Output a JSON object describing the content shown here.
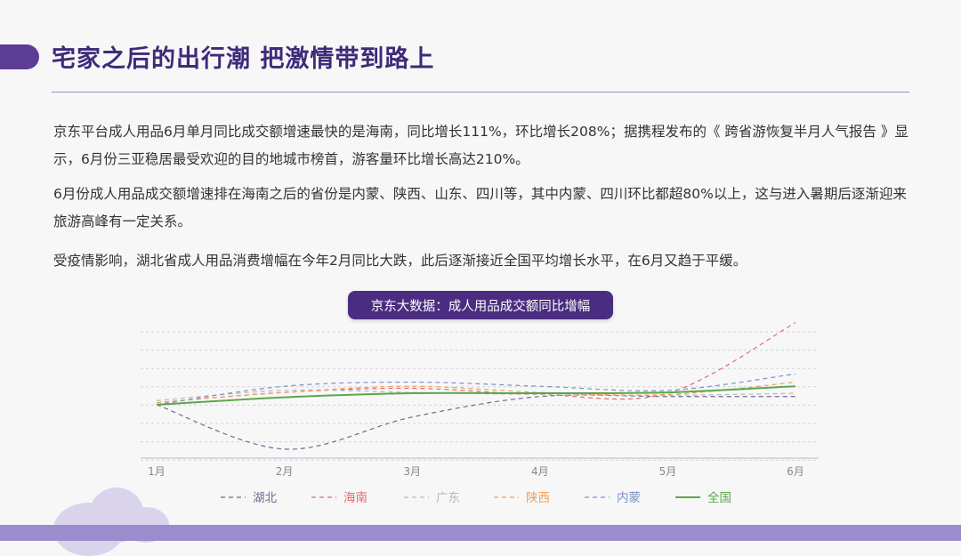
{
  "page": {
    "title": "宅家之后的出行潮 把激情带到路上",
    "paragraphs": [
      "京东平台成人用品6月单月同比成交额增速最快的是海南，同比增长111%，环比增长208%；据携程发布的《 跨省游恢复半月人气报告 》显示，6月份三亚稳居最受欢迎的目的地城市榜首，游客量环比增长高达210%。",
      "6月份成人用品成交额增速排在海南之后的省份是内蒙、陕西、山东、四川等，其中内蒙、四川环比都超80%以上，这与进入暑期后逐渐迎来旅游高峰有一定关系。",
      "受疫情影响，湖北省成人用品消费增幅在今年2月同比大跌，此后逐渐接近全国平均增长水平，在6月又趋于平缓。"
    ],
    "chart_badge": "京东大数据：成人用品成交额同比增幅"
  },
  "colors": {
    "title": "#3e2b78",
    "accent": "#5b3d95",
    "badge_bg": "#4a2d80",
    "band": "#9d8ccd",
    "cloud": "#d9d3ec"
  },
  "chart_data": {
    "type": "line",
    "categories": [
      "1月",
      "2月",
      "3月",
      "4月",
      "5月",
      "6月"
    ],
    "ylim": [
      -130,
      210
    ],
    "grid": true,
    "y_axis_labels": false,
    "legend_position": "bottom",
    "series": [
      {
        "name": "湖北",
        "color": "#6e6a8e",
        "dashed": true,
        "width": 1.2,
        "values": [
          0,
          -108,
          -30,
          20,
          20,
          20
        ]
      },
      {
        "name": "海南",
        "color": "#e06c6c",
        "dashed": true,
        "width": 1.2,
        "values": [
          5,
          30,
          40,
          25,
          28,
          200
        ]
      },
      {
        "name": "广东",
        "color": "#b8b8b8",
        "dashed": true,
        "width": 1.2,
        "values": [
          10,
          35,
          30,
          25,
          23,
          28
        ]
      },
      {
        "name": "陕西",
        "color": "#f0a05a",
        "dashed": true,
        "width": 1.2,
        "values": [
          5,
          30,
          45,
          30,
          25,
          55
        ]
      },
      {
        "name": "内蒙",
        "color": "#7b93c9",
        "dashed": true,
        "width": 1.2,
        "values": [
          0,
          45,
          55,
          45,
          35,
          75
        ]
      },
      {
        "name": "全国",
        "color": "#5aa84a",
        "dashed": false,
        "width": 2,
        "values": [
          0,
          18,
          28,
          28,
          30,
          45
        ]
      }
    ]
  }
}
